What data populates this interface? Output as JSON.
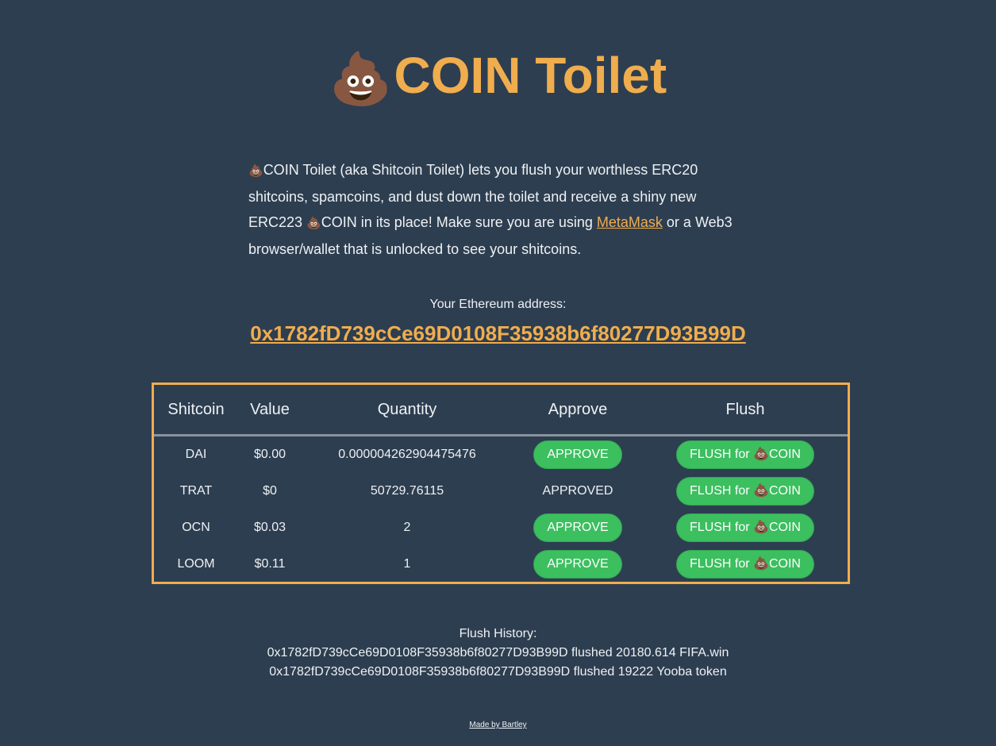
{
  "header": {
    "emoji": "💩",
    "title": "COIN Toilet"
  },
  "intro": {
    "emoji": "💩",
    "text_part1": "COIN Toilet (aka Shitcoin Toilet) lets you flush your worthless ERC20 shitcoins, spamcoins, and dust down the toilet and receive a shiny new ERC223 ",
    "emoji2": "💩",
    "text_part2": "COIN in its place! Make sure you are using ",
    "metamask_link": "MetaMask",
    "text_part3": " or a Web3 browser/wallet that is unlocked to see your shitcoins."
  },
  "address": {
    "label": "Your Ethereum address:",
    "value": "0x1782fD739cCe69D0108F35938b6f80277D93B99D"
  },
  "table": {
    "headers": [
      "Shitcoin",
      "Value",
      "Quantity",
      "Approve",
      "Flush"
    ],
    "rows": [
      {
        "coin": "DAI",
        "value": "$0.00",
        "quantity": "0.000004262904475476",
        "approve": "APPROVE",
        "approved": false,
        "flush": "FLUSH for 💩COIN"
      },
      {
        "coin": "TRAT",
        "value": "$0",
        "quantity": "50729.76115",
        "approve": "APPROVED",
        "approved": true,
        "flush": "FLUSH for 💩COIN"
      },
      {
        "coin": "OCN",
        "value": "$0.03",
        "quantity": "2",
        "approve": "APPROVE",
        "approved": false,
        "flush": "FLUSH for 💩COIN"
      },
      {
        "coin": "LOOM",
        "value": "$0.11",
        "quantity": "1",
        "approve": "APPROVE",
        "approved": false,
        "flush": "FLUSH for 💩COIN"
      }
    ]
  },
  "history": {
    "label": "Flush History:",
    "entries": [
      "0x1782fD739cCe69D0108F35938b6f80277D93B99D flushed 20180.614 FIFA.win",
      "0x1782fD739cCe69D0108F35938b6f80277D93B99D flushed 19222 Yooba token"
    ]
  },
  "footer": {
    "link": "Made by Bartley"
  },
  "colors": {
    "background": "#2d3e50",
    "accent": "#f0ad4e",
    "button": "#3bbf5f"
  }
}
